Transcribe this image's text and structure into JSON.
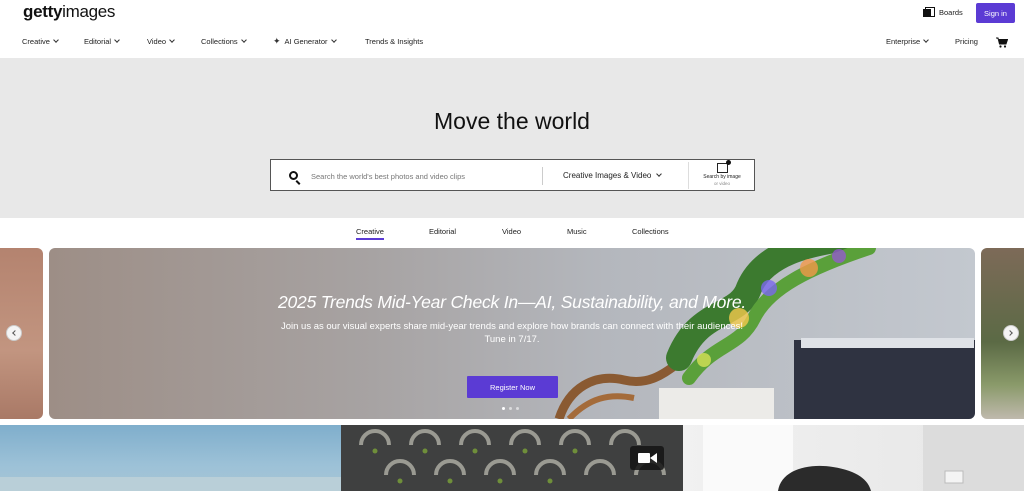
{
  "header": {
    "logo_bold": "getty",
    "logo_light": "images",
    "boards_label": "Boards",
    "signin_label": "Sign in"
  },
  "nav": {
    "items": [
      {
        "label": "Creative",
        "has_menu": true
      },
      {
        "label": "Editorial",
        "has_menu": true
      },
      {
        "label": "Video",
        "has_menu": true
      },
      {
        "label": "Collections",
        "has_menu": true
      },
      {
        "label": "AI Generator",
        "has_menu": true,
        "icon": "sparkle-icon"
      },
      {
        "label": "Trends & Insights",
        "has_menu": false
      }
    ],
    "right": [
      {
        "label": "Enterprise",
        "has_menu": true
      },
      {
        "label": "Pricing",
        "has_menu": false
      }
    ],
    "cart_icon": "cart-icon"
  },
  "hero": {
    "title": "Move the world",
    "search": {
      "placeholder": "Search the world's best photos and video clips",
      "type_label": "Creative Images & Video",
      "search_by_image": "Search by image",
      "search_by_image_sub": "or video"
    }
  },
  "tabs": {
    "items": [
      "Creative",
      "Editorial",
      "Video",
      "Music",
      "Collections"
    ],
    "active": "Creative"
  },
  "promo": {
    "title": "2025 Trends Mid-Year Check In—AI, Sustainability, and More.",
    "body_line1": "Join us as our visual experts share mid-year trends and explore how brands can connect with their audiences!",
    "body_line2": "Tune in 7/17.",
    "cta_label": "Register Now",
    "slide_count": 3,
    "active_slide": 1
  },
  "colors": {
    "accent": "#5b3bd4",
    "hero_bg": "#e8e8e8"
  }
}
